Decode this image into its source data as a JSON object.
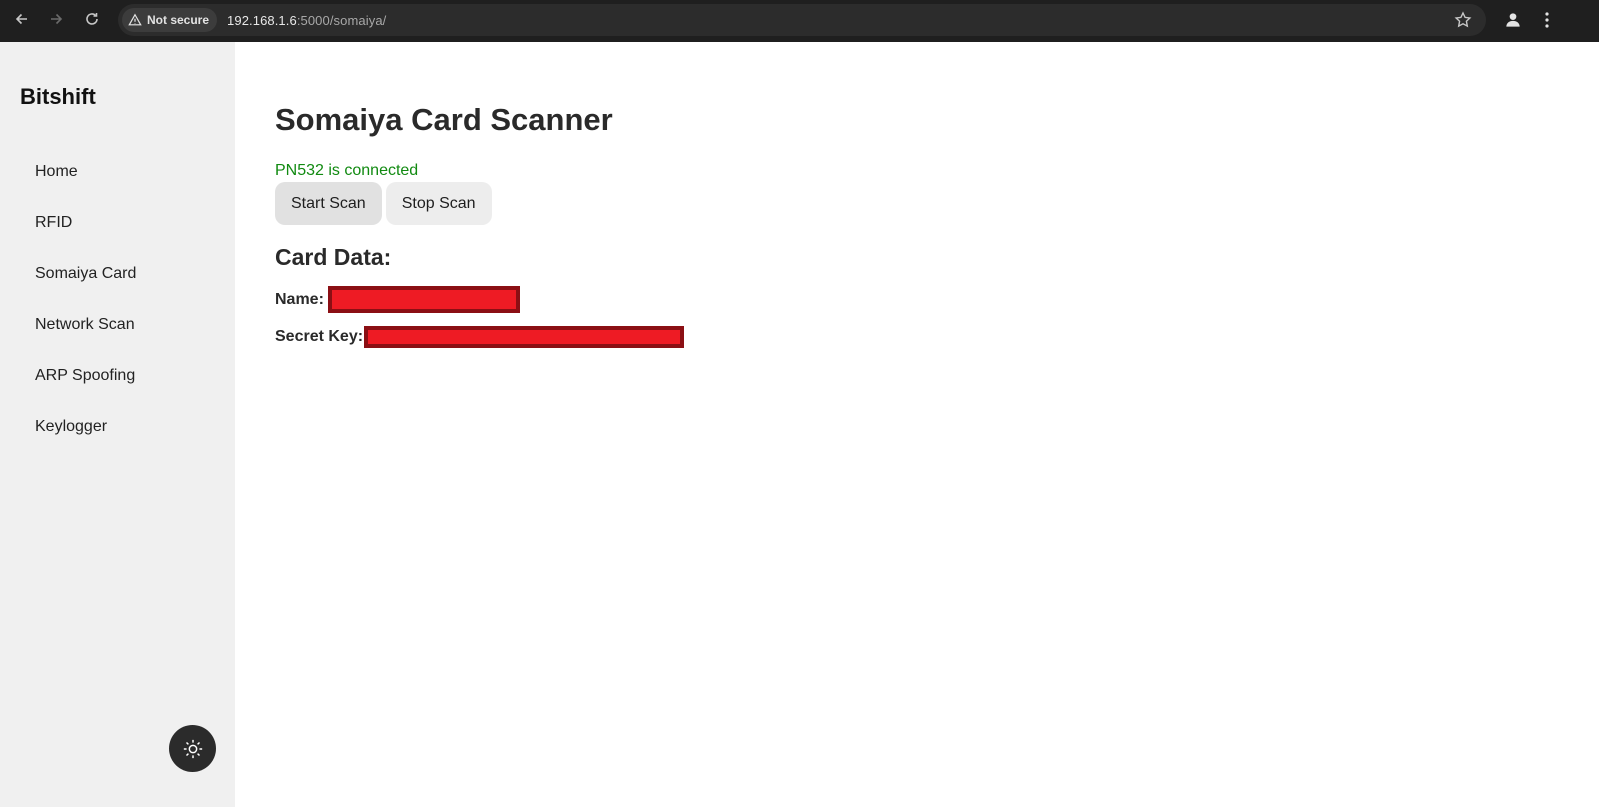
{
  "browser": {
    "security_label": "Not secure",
    "url_host": "192.168.1.6",
    "url_path": ":5000/somaiya/"
  },
  "sidebar": {
    "brand": "Bitshift",
    "items": [
      {
        "label": "Home"
      },
      {
        "label": "RFID"
      },
      {
        "label": "Somaiya Card"
      },
      {
        "label": "Network Scan"
      },
      {
        "label": "ARP Spoofing"
      },
      {
        "label": "Keylogger"
      }
    ],
    "theme_toggle_icon": "sun-icon"
  },
  "main": {
    "title": "Somaiya Card Scanner",
    "status": "PN532 is connected",
    "status_color": "#118a11",
    "buttons": {
      "start": "Start Scan",
      "stop": "Stop Scan"
    },
    "card_data": {
      "heading": "Card Data:",
      "name_label": "Name:",
      "secret_key_label": "Secret Key:"
    }
  }
}
